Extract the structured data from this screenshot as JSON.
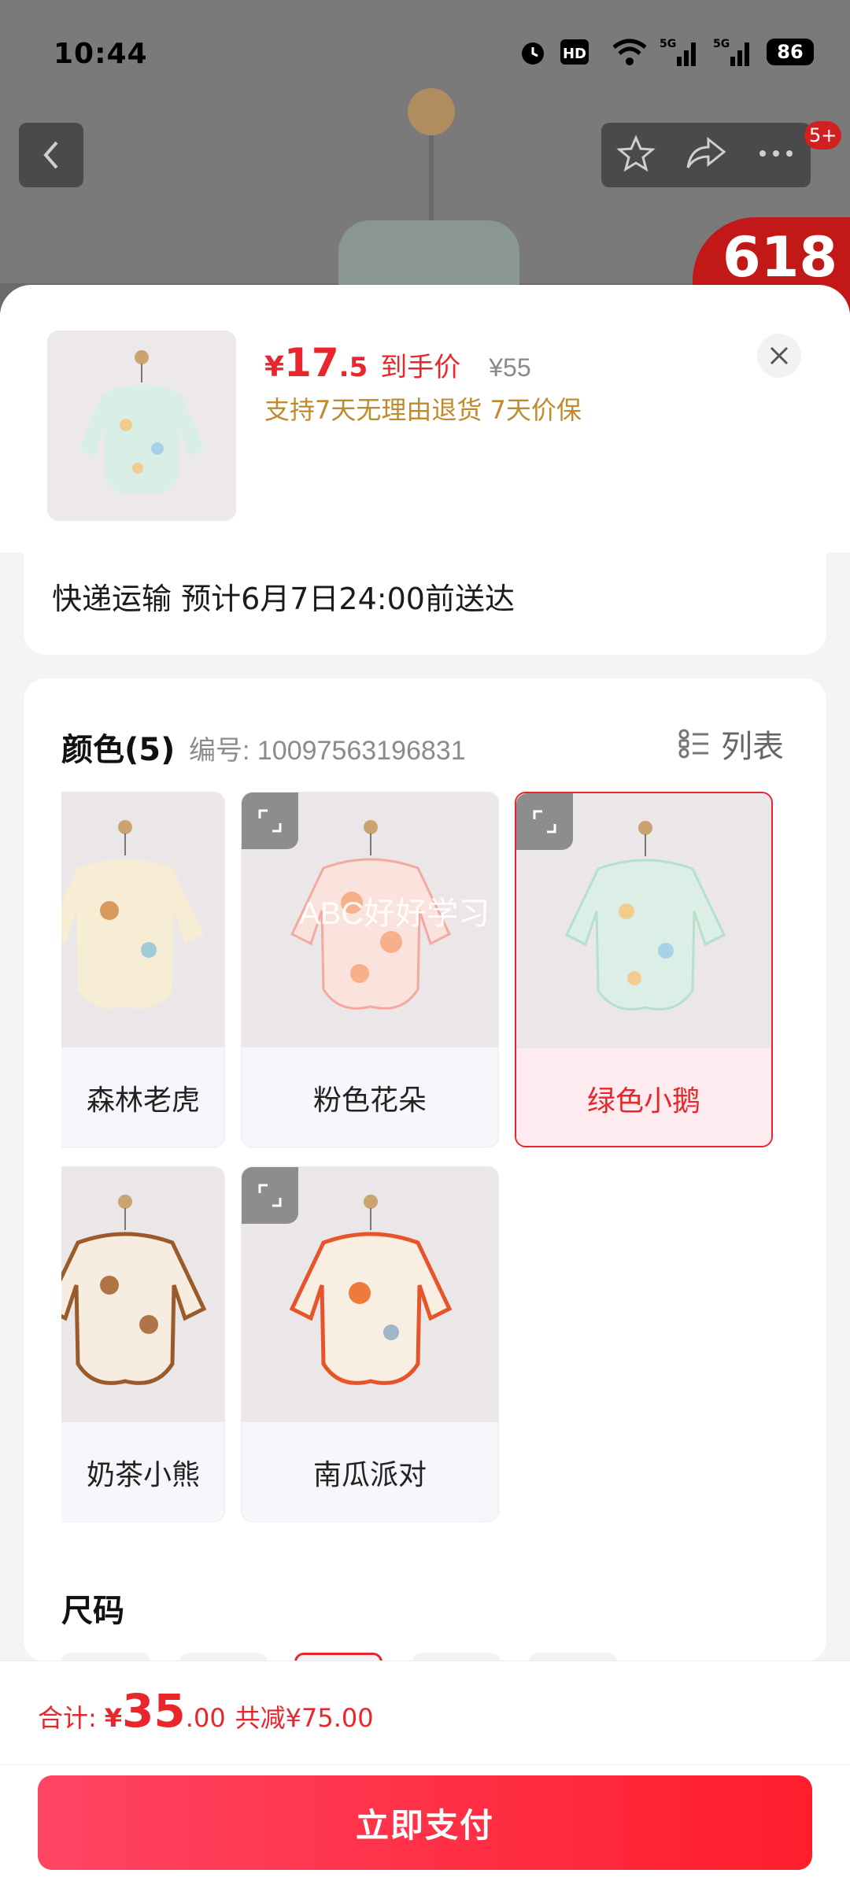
{
  "status_bar": {
    "time": "10:44",
    "icons": [
      "alarm-icon",
      "hd-icon",
      "wifi-icon",
      "5g-signal-icon",
      "5g-signal-icon"
    ],
    "battery": "86"
  },
  "top_nav": {
    "back_icon": "chevron-left-icon",
    "actions": [
      "star-icon",
      "share-icon",
      "more-icon"
    ],
    "badge": "5+"
  },
  "background": {
    "promo": "618"
  },
  "product": {
    "price_yen": "¥",
    "price_int": "17",
    "price_dec": ".5",
    "price_label": "到手价",
    "original_price": "¥55",
    "guarantee": "支持7天无理由退货  7天价保"
  },
  "delivery": {
    "text": "快递运输 预计6月7日24:00前送达"
  },
  "color_section": {
    "title": "颜色(5)",
    "code": "编号: 10097563196831",
    "view_label": "列表",
    "options": [
      {
        "label": "森林老虎",
        "selected": false
      },
      {
        "label": "粉色花朵",
        "selected": false
      },
      {
        "label": "绿色小鹅",
        "selected": true
      },
      {
        "label": "奶茶小熊",
        "selected": false
      },
      {
        "label": "南瓜派对",
        "selected": false
      }
    ],
    "watermark": "ABC好好学习"
  },
  "size_section": {
    "title": "尺码"
  },
  "checkout": {
    "total_label": "合计:",
    "total_yen": "¥",
    "total_int": "35",
    "total_dec": ".00",
    "total_saved": "共减¥75.00",
    "pay_label": "立即支付"
  },
  "colors": {
    "accent": "#e8262b",
    "guarantee": "#c18a2b",
    "selected_bg": "#fdebef"
  }
}
